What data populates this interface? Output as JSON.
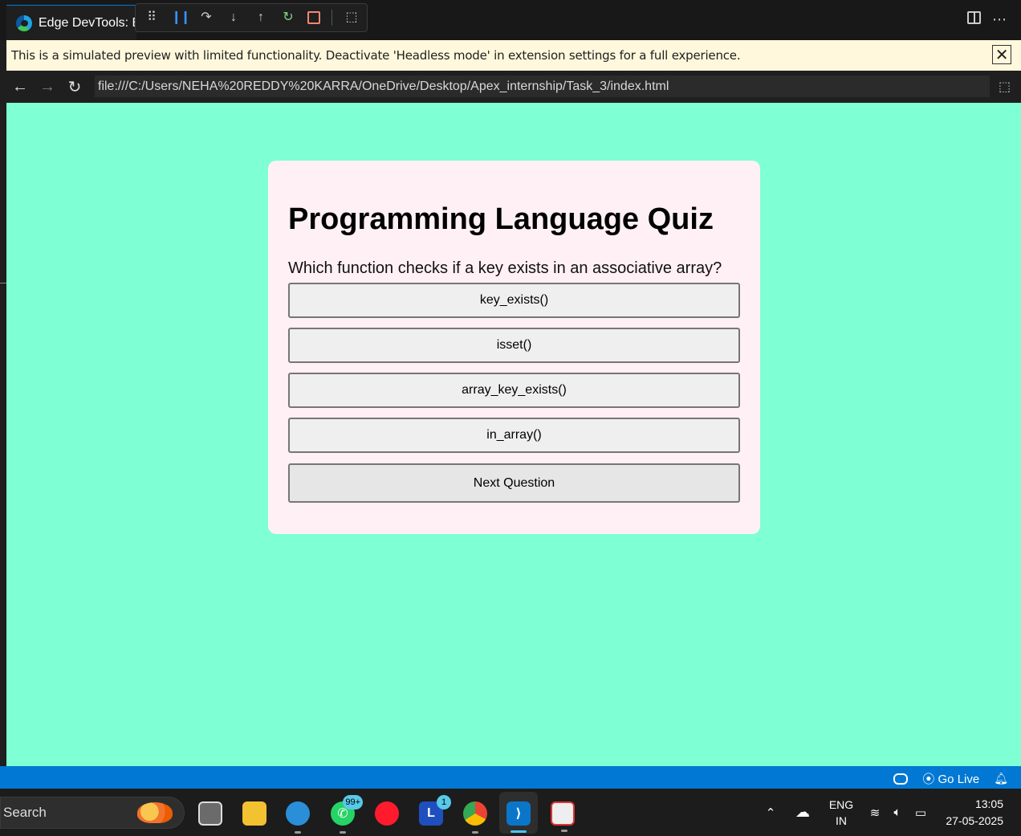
{
  "window": {
    "tab_title": "Edge DevTools: B",
    "title_more": "⋯"
  },
  "notice": {
    "text": "This is a simulated preview with limited functionality. Deactivate 'Headless mode' in extension settings for a full experience.",
    "close": "✕"
  },
  "addressbar": {
    "url": "file:///C:/Users/NEHA%20REDDY%20KARRA/OneDrive/Desktop/Apex_internship/Task_3/index.html",
    "back": "←",
    "forward": "→",
    "refresh": "↻"
  },
  "quiz": {
    "title": "Programming Language Quiz",
    "question": "Which function checks if a key exists in an associative array?",
    "options": [
      "key_exists()",
      "isset()",
      "array_key_exists()",
      "in_array()"
    ],
    "next_label": "Next Question"
  },
  "statusbar": {
    "go_live": "Go Live"
  },
  "taskbar": {
    "search_label": "Search",
    "whatsapp_badge": "99+",
    "l_badge": "1",
    "language_top": "ENG",
    "language_bottom": "IN",
    "time": "13:05",
    "date": "27-05-2025"
  },
  "colors": {
    "page_background": "#7fffd4",
    "card_background": "#fff0f5",
    "statusbar": "#0078d4",
    "notice_background": "#fff8dc"
  }
}
